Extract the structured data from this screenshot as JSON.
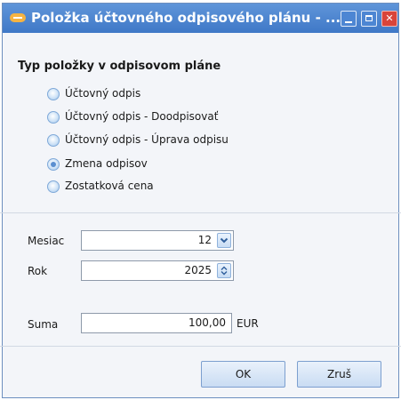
{
  "window": {
    "title": "Položka účtovného odpisového plánu - ...",
    "controls": {
      "minimize": "",
      "maximize": "",
      "close": "✕"
    }
  },
  "group": {
    "title": "Typ položky v odpisovom pláne",
    "options": [
      {
        "label": "Účtovný odpis",
        "checked": false
      },
      {
        "label": "Účtovný odpis - Doodpisovať",
        "checked": false
      },
      {
        "label": "Účtovný odpis - Úprava odpisu",
        "checked": false
      },
      {
        "label": "Zmena odpisov",
        "checked": true
      },
      {
        "label": "Zostatková cena",
        "checked": false
      }
    ]
  },
  "fields": {
    "month": {
      "label": "Mesiac",
      "value": "12"
    },
    "year": {
      "label": "Rok",
      "value": "2025"
    },
    "sum": {
      "label": "Suma",
      "value": "100,00",
      "currency": "EUR"
    }
  },
  "buttons": {
    "ok": "OK",
    "cancel": "Zruš"
  },
  "colors": {
    "titlebar": "#4a86d2",
    "close": "#d9443a",
    "accent": "#5a8fd0"
  },
  "icons": [
    "app-icon",
    "minimize-icon",
    "maximize-icon",
    "close-icon",
    "chevron-down-icon",
    "spinner-icon"
  ]
}
